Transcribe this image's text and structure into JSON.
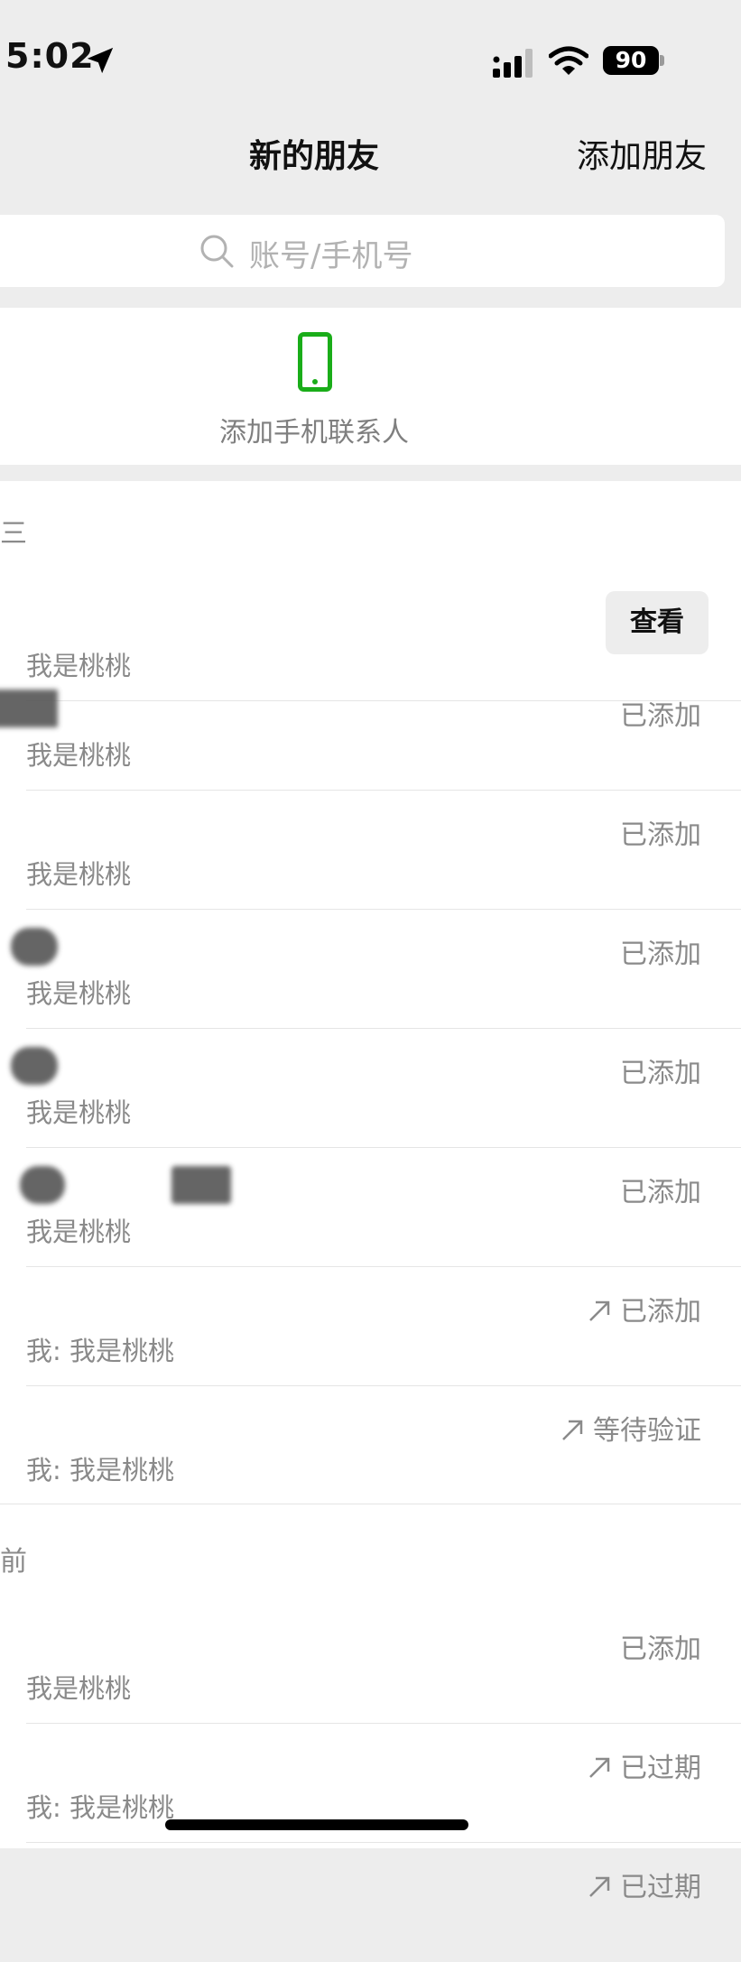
{
  "status_bar": {
    "time": "5:02",
    "battery": "90"
  },
  "nav": {
    "title": "新的朋友",
    "add_friend": "添加朋友"
  },
  "search": {
    "placeholder": "账号/手机号"
  },
  "phone_contacts": {
    "label": "添加手机联系人"
  },
  "sections": [
    {
      "header": "三"
    },
    {
      "header": "前"
    }
  ],
  "rows": [
    {
      "msg": "我是桃桃",
      "action": "查看"
    },
    {
      "msg": "我是桃桃",
      "status": "已添加"
    },
    {
      "msg": "我是桃桃",
      "status": "已添加"
    },
    {
      "msg": "我是桃桃",
      "status": "已添加"
    },
    {
      "msg": "我是桃桃",
      "status": "已添加"
    },
    {
      "msg": "我是桃桃",
      "status": "已添加"
    },
    {
      "msg": "我: 我是桃桃",
      "status": "已添加"
    },
    {
      "msg": "我: 我是桃桃",
      "status": "等待验证"
    },
    {
      "msg": "我是桃桃",
      "status": "已添加"
    },
    {
      "msg": "我: 我是桃桃",
      "status": "已过期"
    },
    {
      "msg": "",
      "status": "已过期"
    }
  ],
  "colors": {
    "accent_green": "#1aad19",
    "background": "#ededed"
  }
}
